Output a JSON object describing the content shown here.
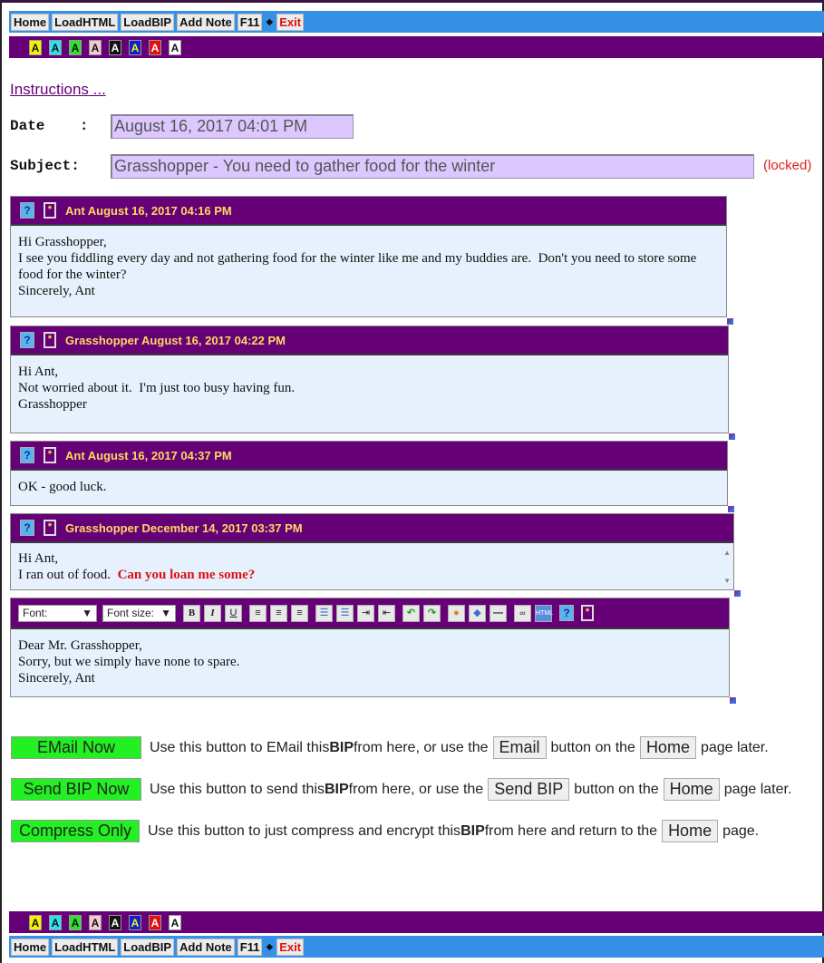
{
  "nav": {
    "buttons": [
      "Home",
      "LoadHTML",
      "LoadBIP",
      "Add Note",
      "F11"
    ],
    "separator": "◆",
    "exit": "Exit"
  },
  "color_buttons": [
    {
      "label": "A",
      "bg": "#f4f400",
      "fg": "#111111"
    },
    {
      "label": "A",
      "bg": "#30e0f0",
      "fg": "#111111"
    },
    {
      "label": "A",
      "bg": "#30e030",
      "fg": "#111111"
    },
    {
      "label": "A",
      "bg": "#f4c8d0",
      "fg": "#111111"
    },
    {
      "label": "A",
      "bg": "#111111",
      "fg": "#ffffff"
    },
    {
      "label": "A",
      "bg": "#1020d0",
      "fg": "#f4f400"
    },
    {
      "label": "A",
      "bg": "#e01010",
      "fg": "#ffffff"
    },
    {
      "label": "A",
      "bg": "#ffffff",
      "fg": "#111111"
    }
  ],
  "instructions_link": "Instructions ...",
  "date": {
    "label": "Date    :",
    "value": "August 16, 2017  04:01 PM"
  },
  "subject": {
    "label": "Subject:",
    "value": "Grasshopper - You need to gather food for the winter",
    "status": "(locked)"
  },
  "messages": [
    {
      "title": "Ant August 16, 2017 04:16 PM",
      "body": "Hi Grasshopper,\nI see you fiddling every day and not gathering food for the winter like me and my buddies are.  Don't you need to store some food for the winter?\nSincerely, Ant"
    },
    {
      "title": "Grasshopper August 16, 2017 04:22 PM",
      "body": "Hi Ant,\nNot worried about it.  I'm just too busy having fun.\nGrasshopper"
    },
    {
      "title": "Ant August 16, 2017 04:37 PM",
      "body": "OK - good luck."
    },
    {
      "title": "Grasshopper December 14, 2017 03:37 PM",
      "body_line1": "Hi Ant,",
      "body_line2": "I ran out of food.  ",
      "body_highlight": "Can you loan me some?"
    }
  ],
  "editor": {
    "font_select": "Font:",
    "size_select": "Font size:",
    "tools": {
      "bold": "B",
      "italic": "I",
      "underline": "U",
      "help": "?",
      "star": "*"
    },
    "body": "Dear Mr. Grasshopper,\nSorry, but we simply have none to spare.\nSincerely, Ant"
  },
  "actions": [
    {
      "button": "EMail Now",
      "text_a": "Use this button to EMail this ",
      "bold": "BIP",
      "text_b": " from here, or use the",
      "inline_btn1": "Email",
      "text_c": "button on the",
      "inline_btn2": "Home",
      "text_d": "page later."
    },
    {
      "button": "Send BIP Now",
      "text_a": "Use this button to send this ",
      "bold": "BIP",
      "text_b": " from here, or use the",
      "inline_btn1": "Send BIP",
      "text_c": "button on the",
      "inline_btn2": "Home",
      "text_d": "page later."
    },
    {
      "button": "Compress Only",
      "text_a": "Use this button to just compress and encrypt this ",
      "bold": "BIP",
      "text_b": " from here and return to the",
      "inline_btn2": "Home",
      "text_d": "page."
    }
  ]
}
